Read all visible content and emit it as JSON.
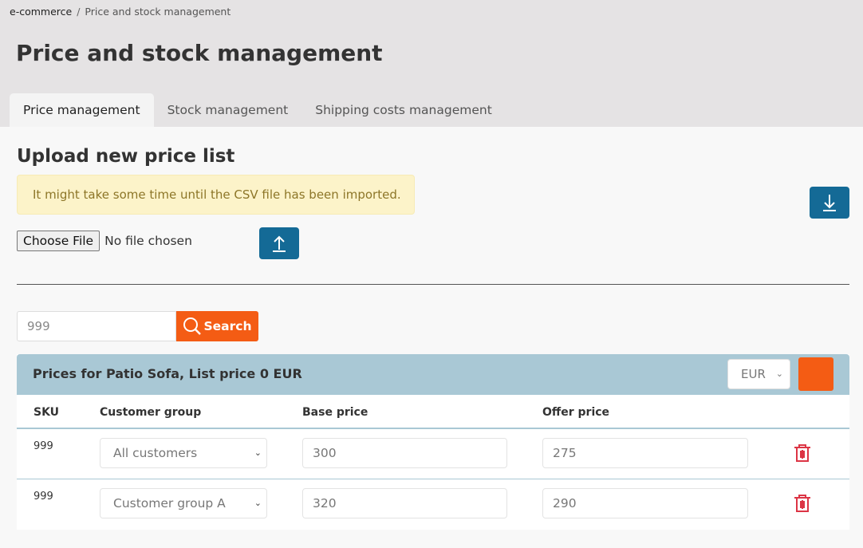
{
  "breadcrumb": {
    "root": "e-commerce",
    "separator": "/",
    "current": "Price and stock management"
  },
  "page_title": "Price and stock management",
  "tabs": [
    {
      "label": "Price management",
      "active": true
    },
    {
      "label": "Stock management"
    },
    {
      "label": "Shipping costs management"
    }
  ],
  "upload": {
    "title": "Upload new price list",
    "alert": "It might take some time until the CSV file has been imported.",
    "choose_file": "Choose File",
    "no_file": "No file chosen",
    "download_icon": "download-icon",
    "upload_icon": "upload-icon"
  },
  "search": {
    "value": "999",
    "button": "Search"
  },
  "panel": {
    "title": "Prices for Patio Sofa, List price 0 EUR",
    "currency": "EUR",
    "columns": [
      "SKU",
      "Customer group",
      "Base price",
      "Offer price"
    ],
    "rows": [
      {
        "sku": "999",
        "group": "All customers",
        "base": "300",
        "offer": "275"
      },
      {
        "sku": "999",
        "group": "Customer group A",
        "base": "320",
        "offer": "290"
      }
    ]
  },
  "colors": {
    "accent": "#f45c14",
    "primary": "#146a96",
    "danger": "#dc3545",
    "panel_header": "#a9c8d5"
  }
}
